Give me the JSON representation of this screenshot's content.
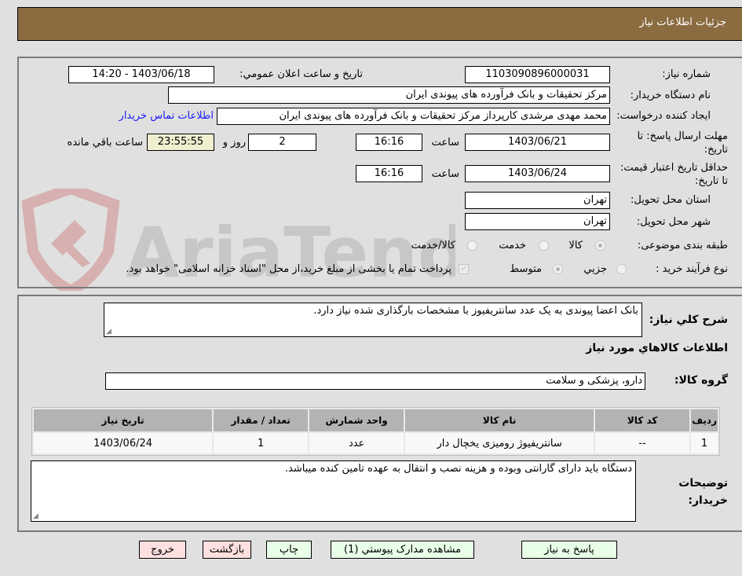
{
  "header": {
    "title": "جزئیات اطلاعات نیاز"
  },
  "details": {
    "need_number": {
      "label": "شماره نیاز:",
      "value": "1103090896000031"
    },
    "announce_datetime": {
      "label": "تاریخ و ساعت اعلان عمومي:",
      "value": "1403/06/18 - 14:20"
    },
    "buyer_org": {
      "label": "نام دستگاه خريدار:",
      "value": "مرکز تحقیقات و بانک فرآورده های پیوندی ایران"
    },
    "requester": {
      "label": "ایجاد کننده درخواست:",
      "value": "محمد مهدی  مرشدی کارپرداز مرکز تحقیقات و بانک فرآورده های پیوندی ایران"
    },
    "buyer_contact_link": "اطلاعات تماس خريدار",
    "reply_deadline": {
      "label": "مهلت ارسال پاسخ: تا تاریخ:",
      "date": "1403/06/21",
      "time_label": "ساعت",
      "time": "16:16",
      "days": "2",
      "days_label": "روز و",
      "remaining": "23:55:55",
      "remaining_label": "ساعت باقي مانده"
    },
    "price_validity": {
      "label": "حداقل تاریخ اعتبار قیمت: تا تاریخ:",
      "date": "1403/06/24",
      "time_label": "ساعت",
      "time": "16:16"
    },
    "province": {
      "label": "استان محل تحویل:",
      "value": "تهران"
    },
    "city": {
      "label": "شهر محل تحویل:",
      "value": "تهران"
    },
    "category": {
      "label": "طبقه بندی موضوعی:",
      "options": [
        "کالا",
        "خدمت",
        "کالا/خدمت"
      ],
      "selected": "کالا"
    },
    "purchase_type": {
      "label": "نوع فرآیند خرید :",
      "options": [
        "جزيي",
        "متوسط"
      ],
      "selected": "متوسط",
      "treasury_note": "پرداخت تمام یا بخشی از مبلغ خرید،از محل \"اسناد خزانه اسلامی\" خواهد بود.",
      "treasury_checked": true
    }
  },
  "watermark": {
    "text": "AriaTender.neT"
  },
  "description": {
    "label": "شرح کلي نياز:",
    "value": "بانک اعضا پیوندی به یک عدد سانتریفیوز با مشخصات بارگذاری  شده نیاز دارد."
  },
  "goods_section": {
    "title": "اطلاعات کالاهاي مورد نياز",
    "group_label": "گروه کالا:",
    "group_value": "دارو، پزشکی و سلامت"
  },
  "items_table": {
    "columns": [
      "رديف",
      "کد کالا",
      "نام کالا",
      "واحد شمارش",
      "تعداد / مقدار",
      "تاريخ نياز"
    ],
    "rows": [
      [
        "1",
        "--",
        "سانتریفیوژ رومیزی یخچال دار",
        "عدد",
        "1",
        "1403/06/24"
      ]
    ]
  },
  "buyer_notes": {
    "label": "توضيحات خريدار:",
    "value": "دستگاه باید دارای گارانتی وبوده و هزینه نصب و انتقال به عهده تامین کنده میباشد."
  },
  "buttons": {
    "reply": "پاسخ به نياز",
    "attachments": "مشاهده مدارک پيوستي (1)",
    "print": "چاپ",
    "back": "بازگشت",
    "exit": "خروج"
  }
}
